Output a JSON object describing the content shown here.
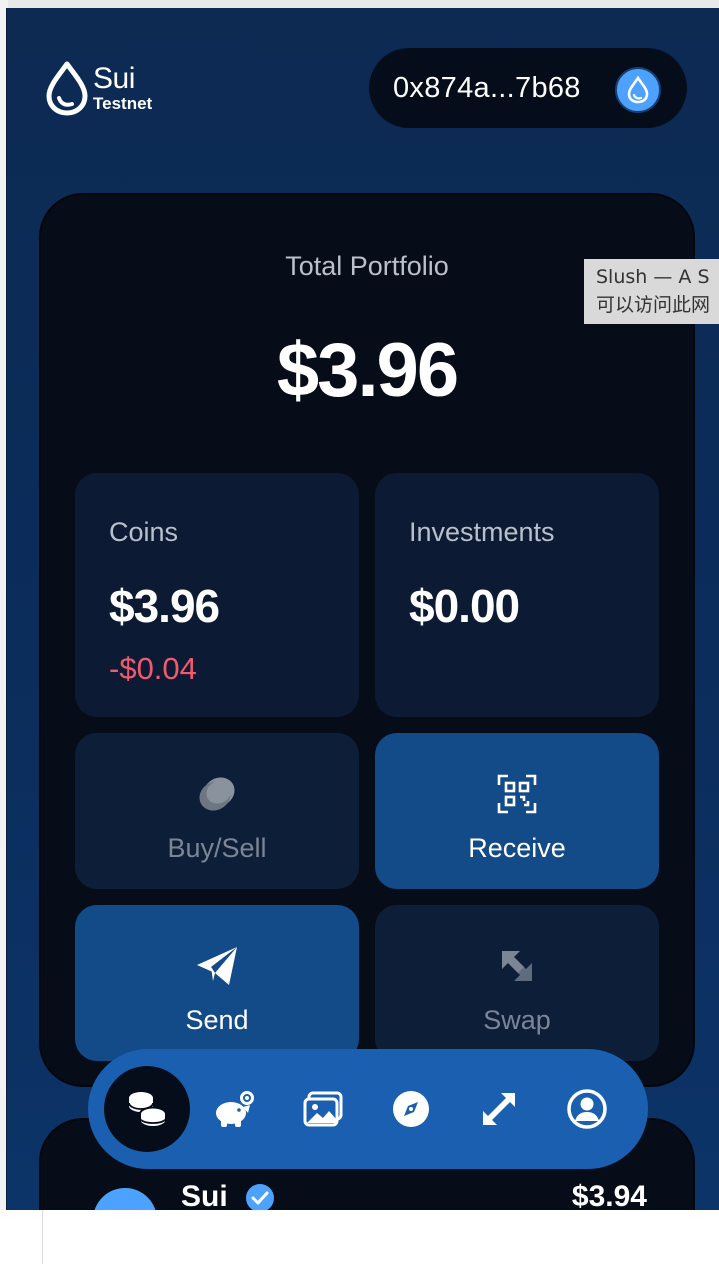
{
  "header": {
    "logo_name": "Sui",
    "network": "Testnet",
    "address": "0x874a...7b68"
  },
  "portfolio": {
    "title": "Total Portfolio",
    "total": "$3.96"
  },
  "coins_tile": {
    "label": "Coins",
    "value": "$3.96",
    "change": "-$0.04"
  },
  "investments_tile": {
    "label": "Investments",
    "value": "$0.00"
  },
  "actions": {
    "buy_sell": "Buy/Sell",
    "receive": "Receive",
    "send": "Send",
    "swap": "Swap"
  },
  "coin_list": {
    "items": [
      {
        "name": "Sui",
        "value": "$3.94"
      }
    ]
  },
  "tooltip": {
    "line1": "Slush — A S",
    "line2": "可以访问此网"
  },
  "colors": {
    "accent": "#4da2ff",
    "negative": "#f0596e",
    "nav_bar": "#1b60b0",
    "card": "#070d18"
  },
  "icons": {
    "nav": [
      "coins-icon",
      "piggy-bank-icon",
      "gallery-icon",
      "compass-icon",
      "swap-icon",
      "account-icon"
    ]
  }
}
